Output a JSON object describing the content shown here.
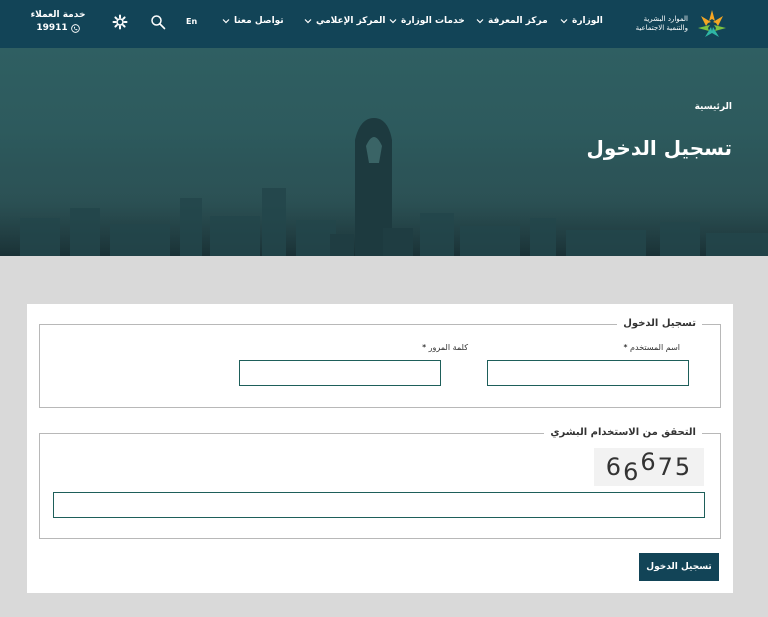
{
  "header": {
    "customer_service": {
      "label": "خدمة العملاء",
      "phone": "19911"
    },
    "language": "En",
    "nav": [
      {
        "label": "تواصل معنا"
      },
      {
        "label": "المركز الإعلامي"
      },
      {
        "label": "خدمات الوزارة"
      },
      {
        "label": "مركز المعرفة"
      },
      {
        "label": "الوزارة"
      }
    ],
    "logo": {
      "line1": "الموارد البشرية",
      "line2": "والتنمية الاجتماعية"
    }
  },
  "hero": {
    "breadcrumb": "الرئيسية",
    "title": "تسجيل الدخول"
  },
  "login_form": {
    "legend": "تسجيل الدخول",
    "username_label": "اسم المستخدم",
    "password_label": "كلمة المرور",
    "required_mark": "*",
    "username_value": "",
    "password_value": ""
  },
  "captcha": {
    "legend": "التحقق من الاستخدام البشري",
    "digits": [
      "6",
      "6",
      "6",
      "7",
      "5"
    ],
    "value": ""
  },
  "submit_label": "تسجيل الدخول",
  "colors": {
    "header_bg": "#124457",
    "button_bg": "#124457",
    "input_border": "#1e5f5a",
    "page_bg": "#d9d9d9"
  }
}
